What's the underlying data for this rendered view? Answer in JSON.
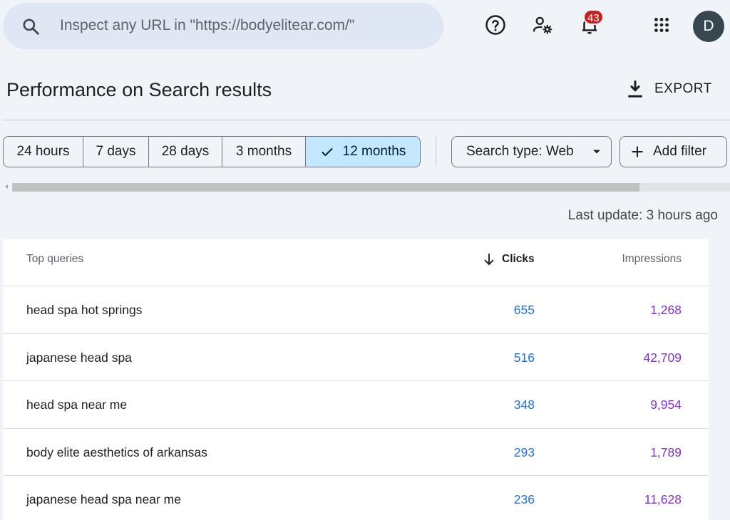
{
  "search": {
    "placeholder": "Inspect any URL in \"https://bodyelitear.com/\"",
    "icon": "search-icon"
  },
  "topbar": {
    "help_icon": "help-icon",
    "settings_icon": "users-settings-icon",
    "notifications_icon": "bell-icon",
    "notifications_count": "43",
    "apps_icon": "apps-grid-icon",
    "avatar_letter": "D"
  },
  "header": {
    "title": "Performance on Search results",
    "export_label": "EXPORT"
  },
  "date_ranges": [
    {
      "label": "24 hours",
      "selected": false
    },
    {
      "label": "7 days",
      "selected": false
    },
    {
      "label": "28 days",
      "selected": false
    },
    {
      "label": "3 months",
      "selected": false
    },
    {
      "label": "12 months",
      "selected": true
    }
  ],
  "filters": {
    "search_type_label": "Search type: Web",
    "add_filter_label": "Add filter"
  },
  "last_update": "Last update: 3 hours ago",
  "table": {
    "headers": {
      "query": "Top queries",
      "clicks": "Clicks",
      "impressions": "Impressions"
    },
    "rows": [
      {
        "query": "head spa hot springs",
        "clicks": "655",
        "impressions": "1,268"
      },
      {
        "query": "japanese head spa",
        "clicks": "516",
        "impressions": "42,709"
      },
      {
        "query": "head spa near me",
        "clicks": "348",
        "impressions": "9,954"
      },
      {
        "query": "body elite aesthetics of arkansas",
        "clicks": "293",
        "impressions": "1,789"
      },
      {
        "query": "japanese head spa near me",
        "clicks": "236",
        "impressions": "11,628"
      }
    ]
  },
  "colors": {
    "clicks": "#1a73e8",
    "impressions": "#8430ce",
    "selected_chip": "#c2e7ff",
    "badge": "#c5221f"
  }
}
